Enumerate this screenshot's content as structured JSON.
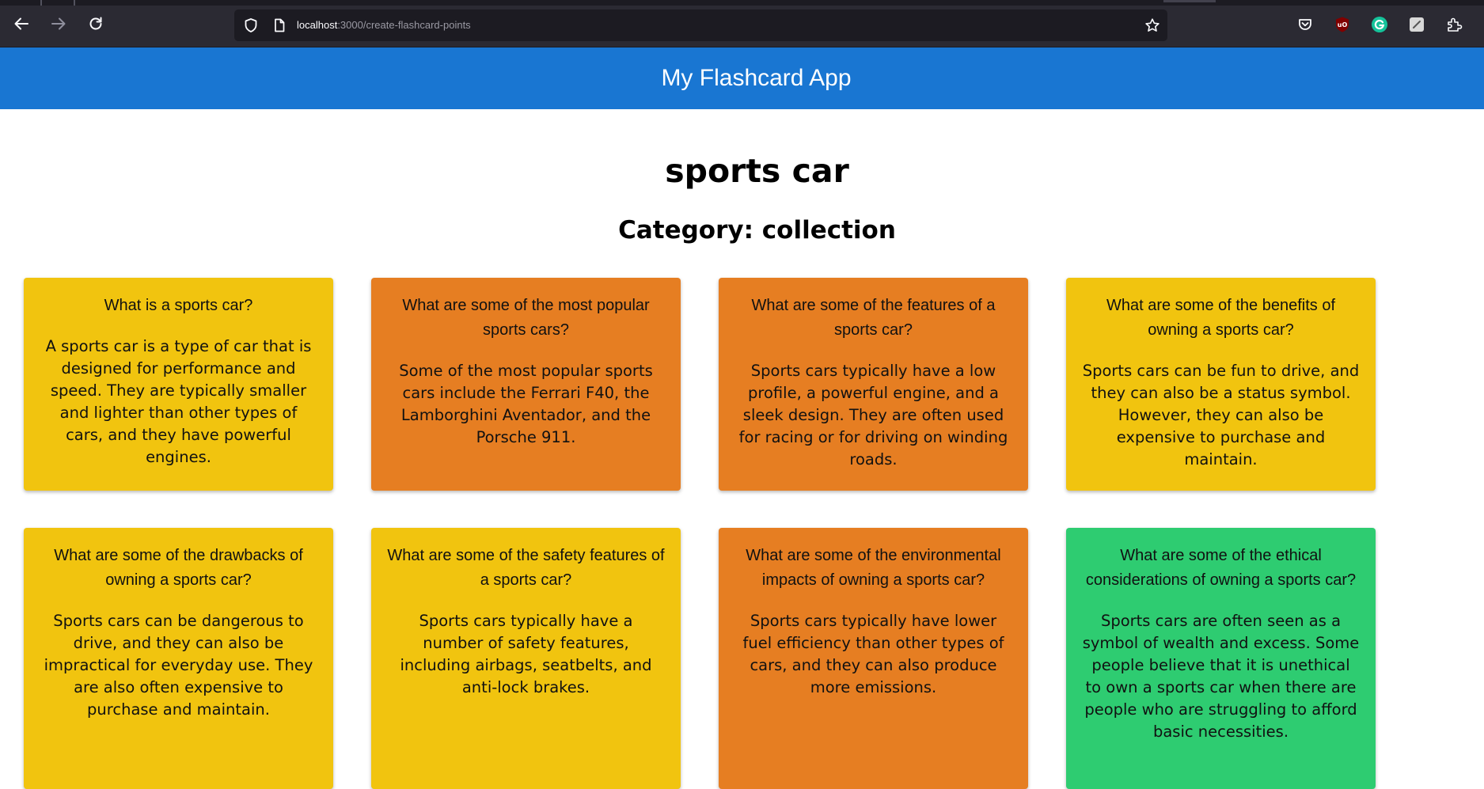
{
  "browser": {
    "url_host": "localhost",
    "url_path": ":3000/create-flashcard-points"
  },
  "header": {
    "title": "My Flashcard App"
  },
  "flashcard_set": {
    "title": "sports car",
    "category": "Category: collection"
  },
  "cards": [
    {
      "color": "#f1c40f",
      "question": "What is a sports car?",
      "answer": "A sports car is a type of car that is designed for performance and speed. They are typically smaller and lighter than other types of cars, and they have powerful engines."
    },
    {
      "color": "#e67e22",
      "question": "What are some of the most popular sports cars?",
      "answer": "Some of the most popular sports cars include the Ferrari F40, the Lamborghini Aventador, and the Porsche 911."
    },
    {
      "color": "#e67e22",
      "question": "What are some of the features of a sports car?",
      "answer": "Sports cars typically have a low profile, a powerful engine, and a sleek design. They are often used for racing or for driving on winding roads."
    },
    {
      "color": "#f1c40f",
      "question": "What are some of the benefits of owning a sports car?",
      "answer": "Sports cars can be fun to drive, and they can also be a status symbol. However, they can also be expensive to purchase and maintain."
    },
    {
      "color": "#f1c40f",
      "question": "What are some of the drawbacks of owning a sports car?",
      "answer": "Sports cars can be dangerous to drive, and they can also be impractical for everyday use. They are also often expensive to purchase and maintain."
    },
    {
      "color": "#f1c40f",
      "question": "What are some of the safety features of a sports car?",
      "answer": "Sports cars typically have a number of safety features, including airbags, seatbelts, and anti-lock brakes."
    },
    {
      "color": "#e67e22",
      "question": "What are some of the environmental impacts of owning a sports car?",
      "answer": "Sports cars typically have lower fuel efficiency than other types of cars, and they can also produce more emissions."
    },
    {
      "color": "#2ecc71",
      "question": "What are some of the ethical considerations of owning a sports car?",
      "answer": "Sports cars are often seen as a symbol of wealth and excess. Some people believe that it is unethical to own a sports car when there are people who are struggling to afford basic necessities."
    }
  ]
}
